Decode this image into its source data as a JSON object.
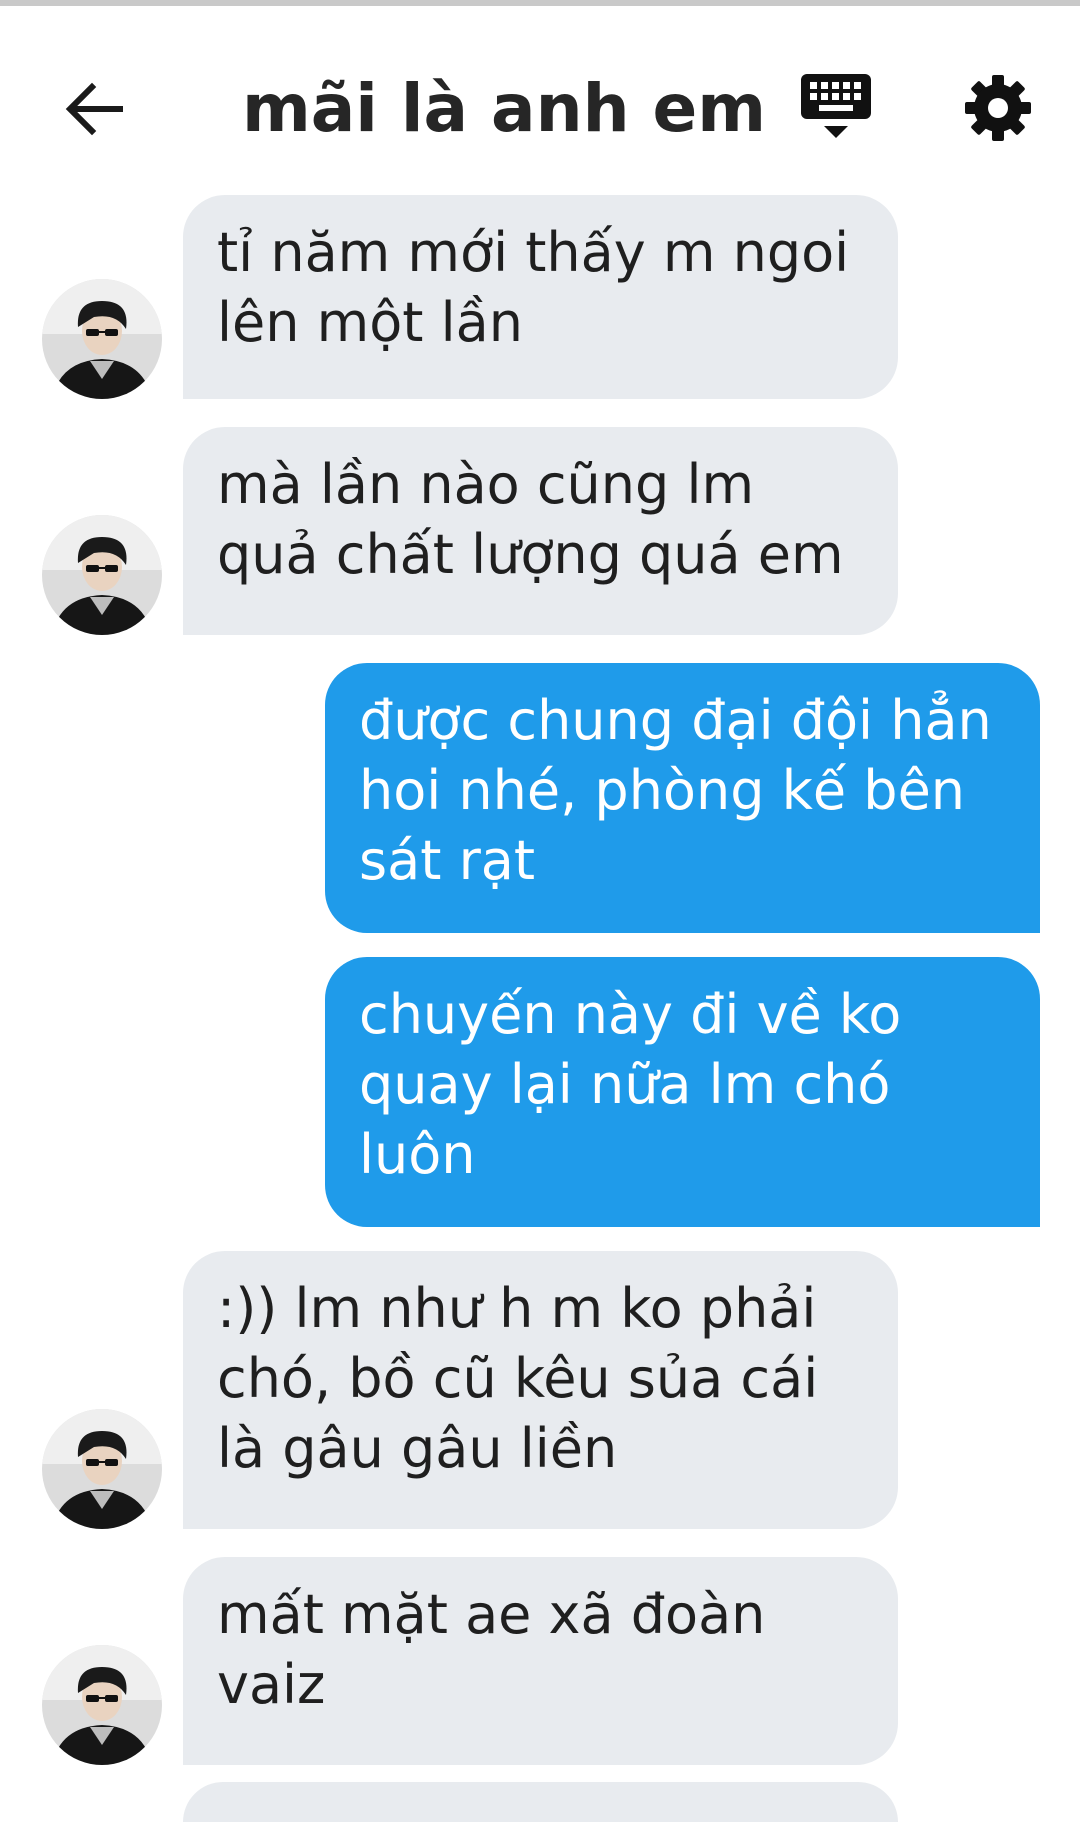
{
  "header": {
    "title": "mãi là anh em",
    "back_icon": "arrow-left-icon",
    "keyboard_icon": "keyboard-icon",
    "settings_icon": "gear-icon"
  },
  "colors": {
    "incoming_bubble": "#e8ebef",
    "outgoing_bubble": "#1f9bea",
    "text_dark": "#1f1f1f",
    "header_text": "#262626"
  },
  "messages": [
    {
      "direction": "in",
      "lines": [
        "tỉ năm mới thấy m ngoi",
        "lên một lần"
      ]
    },
    {
      "direction": "in",
      "lines": [
        "mà lần nào cũng lm",
        "quả chất lượng quá em"
      ]
    },
    {
      "direction": "out",
      "lines": [
        "được chung đại đội hẳn",
        "hoi nhé, phòng kế bên",
        "sát rạt"
      ]
    },
    {
      "direction": "out",
      "lines": [
        "chuyến này đi về ko",
        "quay lại nữa lm chó",
        "luôn"
      ]
    },
    {
      "direction": "in",
      "lines": [
        ":)) lm như h m ko phải",
        "chó, bồ cũ kêu sủa cái",
        "là gâu gâu liền"
      ]
    },
    {
      "direction": "in",
      "lines": [
        "mất mặt ae xã đoàn",
        "vaiz"
      ]
    }
  ]
}
